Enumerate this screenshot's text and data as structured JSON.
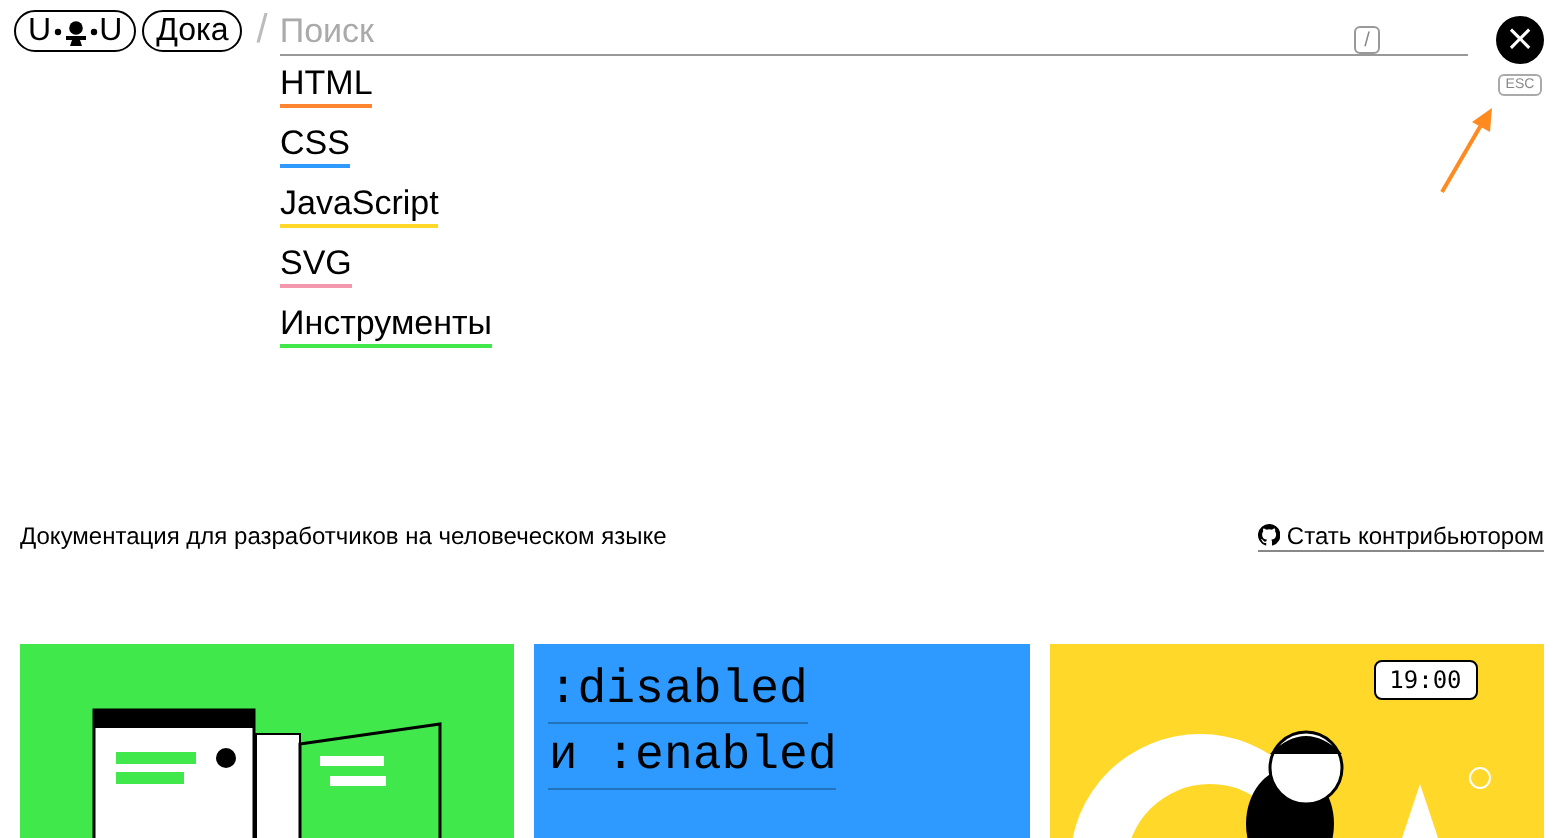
{
  "header": {
    "logo": {
      "left": "U",
      "right": "U"
    },
    "section_link": "Дока",
    "separator": "/",
    "search": {
      "placeholder": "Поиск",
      "shortcut": "/"
    },
    "close": {
      "symbol": "×",
      "hint": "ESC"
    }
  },
  "menu": [
    {
      "label": "HTML",
      "color": "#ff8630"
    },
    {
      "label": "CSS",
      "color": "#2e9aff"
    },
    {
      "label": "JavaScript",
      "color": "#ffd829"
    },
    {
      "label": "SVG",
      "color": "#f498ad"
    },
    {
      "label": "Инструменты",
      "color": "#41e84b"
    }
  ],
  "tagline": "Документация для разработчиков на человеческом языке",
  "contribute_link": "Стать контрибьютором",
  "cards": [
    {
      "kind": "books",
      "color": "#41e84b"
    },
    {
      "kind": "title",
      "color": "#2e9aff",
      "lines": [
        ":disabled",
        "и :enabled"
      ]
    },
    {
      "kind": "clock",
      "color": "#ffd829",
      "time": "19:00"
    }
  ]
}
